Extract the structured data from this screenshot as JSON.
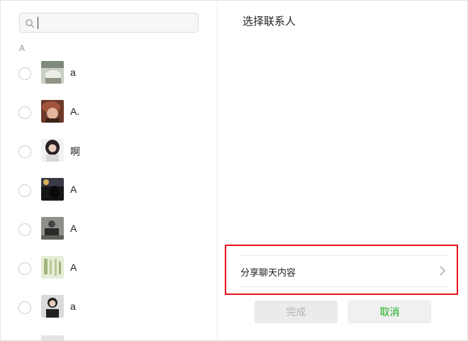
{
  "search": {
    "value": "",
    "placeholder": ""
  },
  "section_letter": "A",
  "contacts": [
    {
      "name": "a"
    },
    {
      "name": "A."
    },
    {
      "name": "啊"
    },
    {
      "name": "A"
    },
    {
      "name": "A"
    },
    {
      "name": "A"
    },
    {
      "name": "a"
    }
  ],
  "right": {
    "title": "选择联系人",
    "share_label": "分享聊天内容"
  },
  "buttons": {
    "done": "完成",
    "cancel": "取消"
  },
  "colors": {
    "highlight": "#e8111a",
    "cancel_text": "#1aad19",
    "done_text_disabled": "#b4b4b4"
  }
}
